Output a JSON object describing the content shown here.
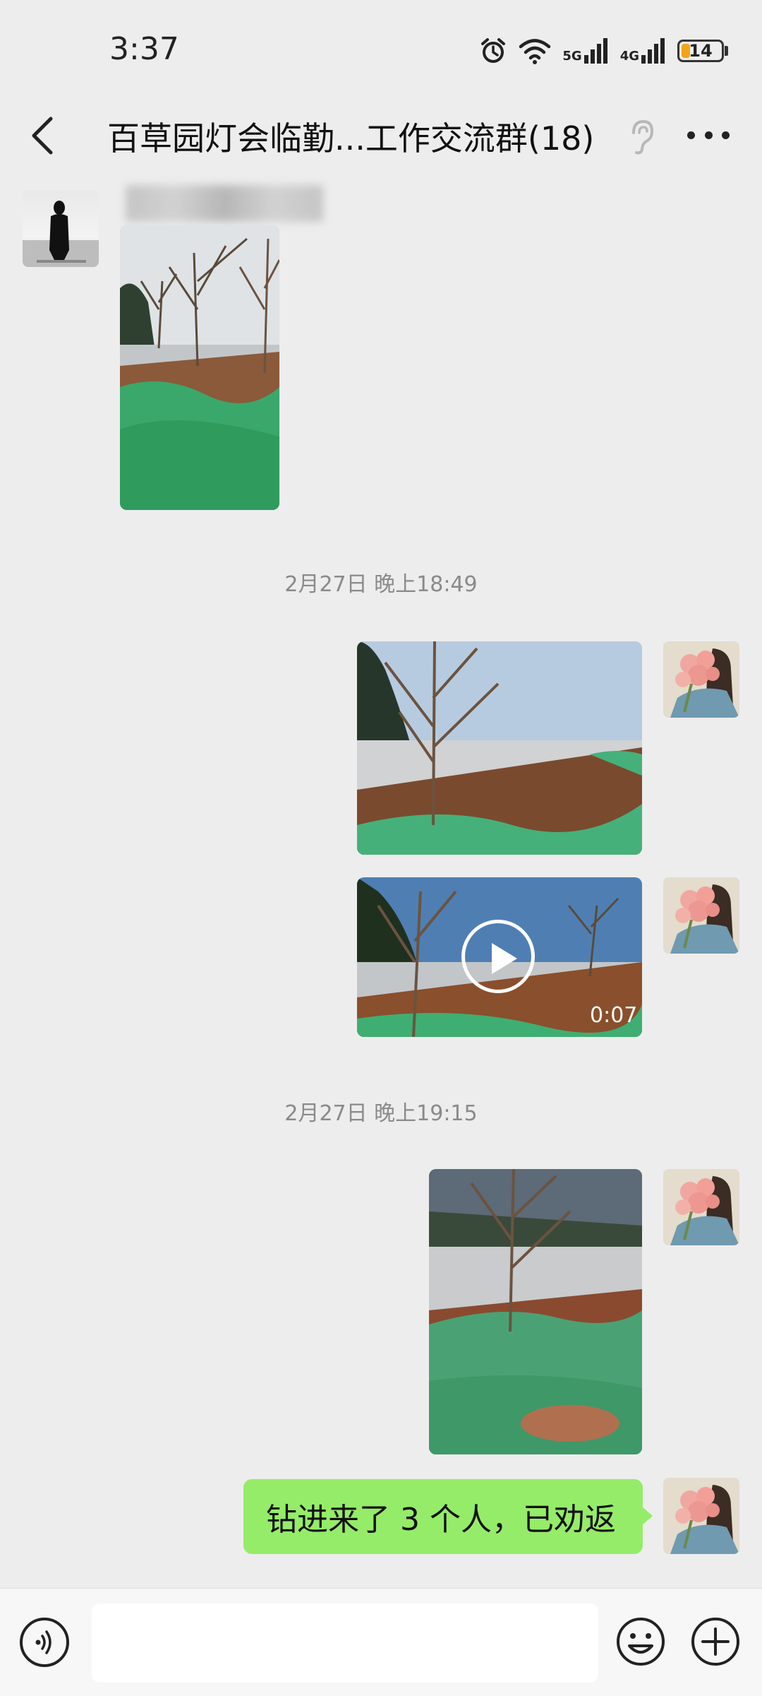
{
  "status_bar": {
    "time": "3:37",
    "network_1": "5G",
    "network_2": "4G",
    "battery": "14",
    "icons": [
      "alarm-icon",
      "wifi-icon",
      "signal-icon",
      "signal-icon",
      "battery-icon"
    ]
  },
  "header": {
    "title": "百草园灯会临勤...工作交流群(18)",
    "icons": [
      "back-icon",
      "ear-icon",
      "more-icon"
    ]
  },
  "messages": [
    {
      "sender": "other",
      "type": "image"
    },
    {
      "type": "timestamp",
      "text": "2月27日 晚上18:49"
    },
    {
      "sender": "self",
      "type": "image"
    },
    {
      "sender": "self",
      "type": "video",
      "duration": "0:07"
    },
    {
      "type": "timestamp",
      "text": "2月27日 晚上19:15"
    },
    {
      "sender": "self",
      "type": "image"
    },
    {
      "sender": "self",
      "type": "text",
      "text": "钻进来了 3 个人，已劝返"
    }
  ],
  "input_bar": {
    "value": "",
    "icons": [
      "voice-icon",
      "emoji-icon",
      "plus-icon"
    ]
  },
  "colors": {
    "background": "#ededed",
    "self_bubble": "#95ec69",
    "timestamp": "#8a8a8a",
    "battery_fill": "#f1a51a"
  }
}
